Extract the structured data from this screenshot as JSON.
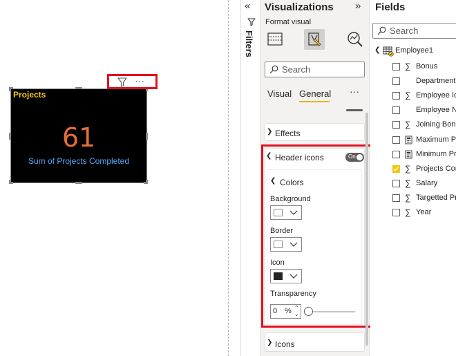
{
  "canvas": {
    "visual": {
      "title": "Projects",
      "value": "61",
      "label": "Sum of Projects Completed",
      "header_icons": [
        "filter-icon",
        "more-options-icon"
      ],
      "more_glyph": "···"
    }
  },
  "filters_pane": {
    "label": "Filters",
    "collapse_glyph": "«"
  },
  "visualizations": {
    "title": "Visualizations",
    "expand_glyph": "»",
    "format_visual_label": "Format visual",
    "search_placeholder": "Search",
    "tabs": [
      {
        "label": "Visual",
        "active": false
      },
      {
        "label": "General",
        "active": true
      }
    ],
    "more_glyph": "···",
    "sections": {
      "effects": "Effects",
      "header_icons": {
        "label": "Header icons",
        "toggle": "On",
        "colors": {
          "label": "Colors",
          "background_label": "Background",
          "background_color": "#ffffff",
          "border_label": "Border",
          "border_color": "#ffffff",
          "icon_label": "Icon",
          "icon_color": "#252423",
          "transparency_label": "Transparency",
          "transparency_value": "0",
          "transparency_unit": "%",
          "transparency_fraction": 0
        }
      },
      "icons": "Icons"
    }
  },
  "fields": {
    "title": "Fields",
    "search_placeholder": "Search",
    "table": "Employee1",
    "items": [
      {
        "name": "Bonus",
        "icon": "sum-icon",
        "checked": false
      },
      {
        "name": "Department",
        "icon": "none",
        "checked": false
      },
      {
        "name": "Employee Id",
        "icon": "sum-icon",
        "checked": false
      },
      {
        "name": "Employee Na",
        "icon": "none",
        "checked": false
      },
      {
        "name": "Joining Bonu",
        "icon": "sum-icon",
        "checked": false
      },
      {
        "name": "Maximum Pr",
        "icon": "calculator-icon",
        "checked": false
      },
      {
        "name": "Minimum Pr",
        "icon": "calculator-icon",
        "checked": false
      },
      {
        "name": "Projects Com",
        "icon": "sum-icon",
        "checked": true
      },
      {
        "name": "Salary",
        "icon": "sum-icon",
        "checked": false
      },
      {
        "name": "Targetted Pr",
        "icon": "sum-icon",
        "checked": false
      },
      {
        "name": "Year",
        "icon": "sum-icon",
        "checked": false
      }
    ]
  },
  "colors": {
    "highlight": "#e0121d",
    "title_yellow": "#f2c811",
    "value_orange": "#e66c37",
    "label_blue": "#5aa7ff",
    "checked": "#f2c811"
  }
}
